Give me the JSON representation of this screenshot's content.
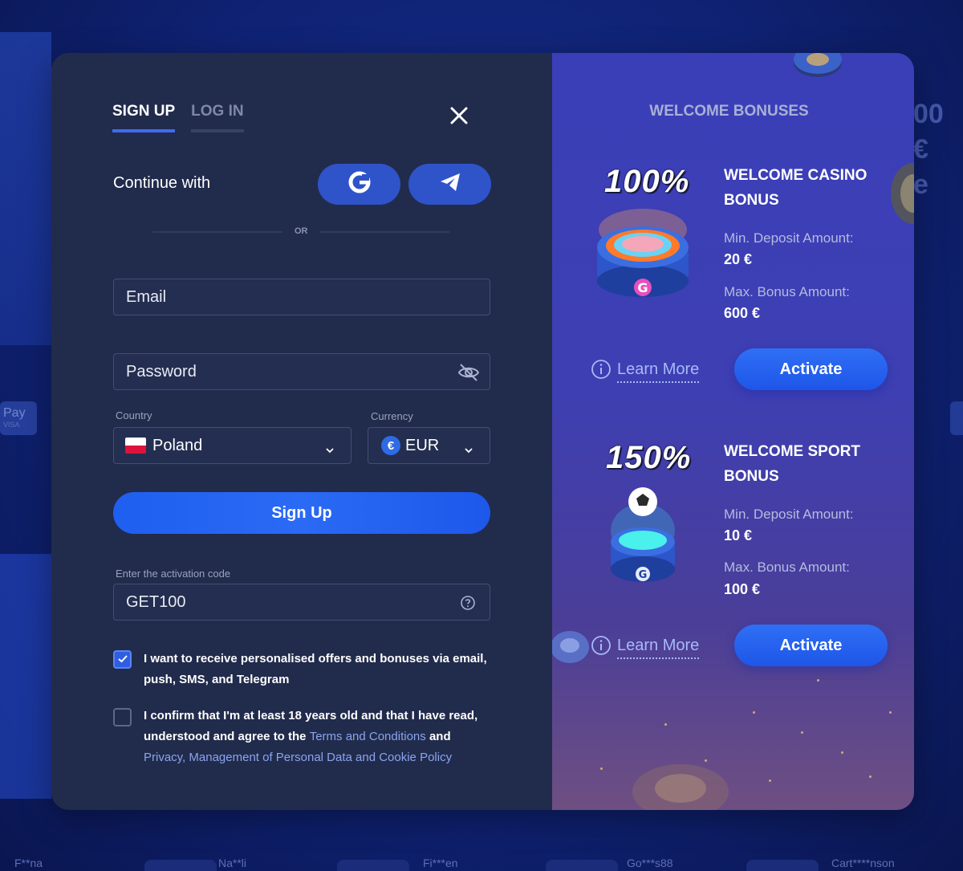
{
  "tabs": [
    {
      "label": "SIGN UP",
      "active": true
    },
    {
      "label": "LOG IN",
      "active": false
    }
  ],
  "continue_label": "Continue with",
  "social": {
    "google_icon": "google-icon",
    "telegram_icon": "telegram-icon"
  },
  "or_label": "OR",
  "email": {
    "placeholder": "Email",
    "value": ""
  },
  "password": {
    "placeholder": "Password",
    "value": ""
  },
  "country": {
    "label": "Country",
    "value": "Poland"
  },
  "currency": {
    "label": "Currency",
    "value": "EUR",
    "symbol": "€"
  },
  "signup_button": "Sign Up",
  "activation": {
    "label": "Enter the activation code",
    "value": "GET100"
  },
  "consent": {
    "offers_text": "I want to receive personalised offers and bonuses via email, push, SMS, and Telegram",
    "offers_checked": true,
    "age_text_prefix": "I confirm that I'm at least 18 years old and that I have read, understood and agree to the",
    "terms_link": "Terms and Conditions",
    "and_word": "and",
    "privacy_link": "Privacy, Management of Personal Data and Cookie Policy",
    "age_checked": false
  },
  "bonuses": {
    "title": "WELCOME BONUSES",
    "items": [
      {
        "percent": "100%",
        "name": "WELCOME CASINO BONUS",
        "min_label": "Min. Deposit Amount:",
        "min_value": "20 €",
        "max_label": "Max. Bonus Amount:",
        "max_value": "600 €",
        "learn_more": "Learn More",
        "activate": "Activate"
      },
      {
        "percent": "150%",
        "name": "WELCOME SPORT BONUS",
        "min_label": "Min. Deposit Amount:",
        "min_value": "10 €",
        "max_label": "Max. Bonus Amount:",
        "max_value": "100 €",
        "learn_more": "Learn More",
        "activate": "Activate"
      }
    ]
  },
  "background": {
    "pay_label": "Pay",
    "pay_sub": "VISA",
    "right_text_1": "00 €",
    "right_text_2": "e",
    "names": [
      "F**na",
      "Na**li",
      "Fi***en",
      "Go***s88",
      "Cart****nson"
    ]
  },
  "colors": {
    "accent": "#2f6ff5",
    "panel_left": "#212b4c",
    "link": "#8aa4ee"
  }
}
